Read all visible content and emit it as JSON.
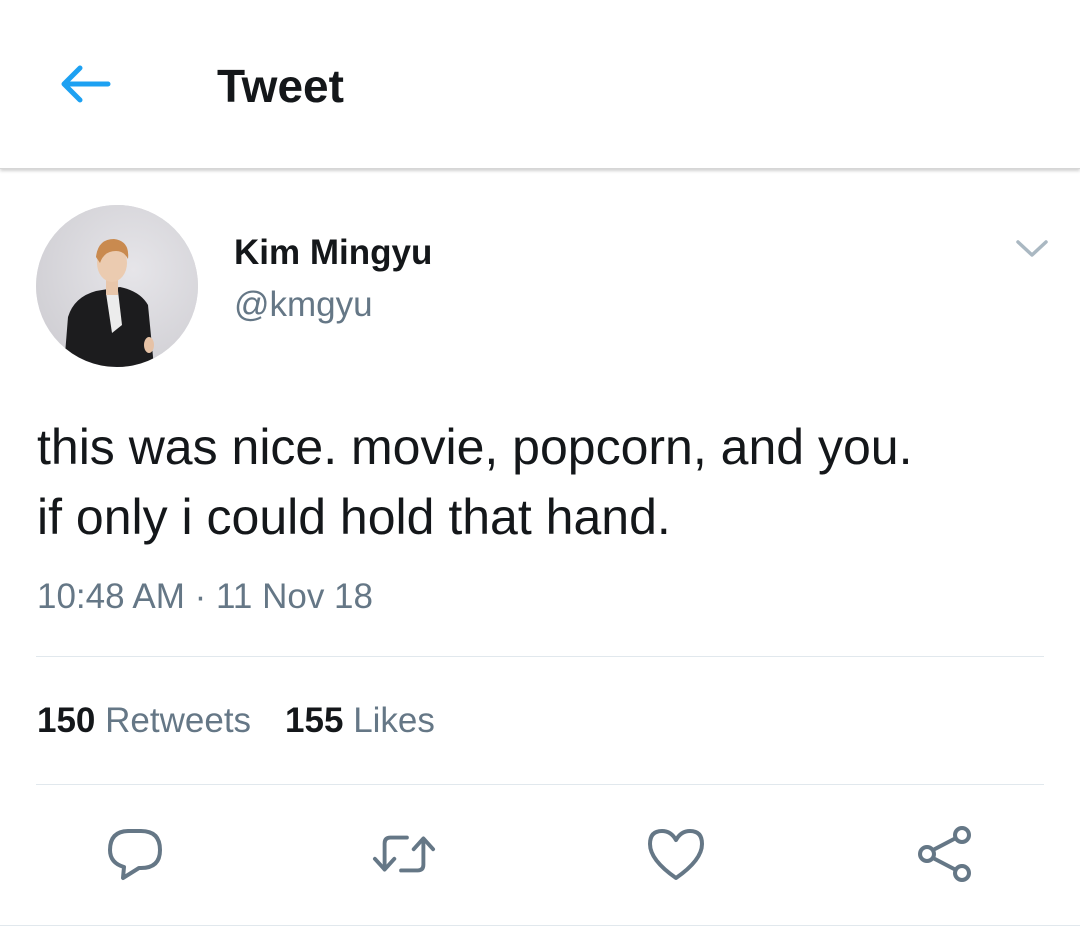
{
  "header": {
    "title": "Tweet"
  },
  "tweet": {
    "author": {
      "name": "Kim Mingyu",
      "handle": "@kmgyu"
    },
    "text_lines": [
      "this was nice. movie, popcorn, and you.",
      "if only i could hold that hand."
    ],
    "time": "10:48 AM",
    "separator": "·",
    "date": "11 Nov 18",
    "stats": {
      "retweets_count": "150",
      "retweets_label": "Retweets",
      "likes_count": "155",
      "likes_label": "Likes"
    }
  },
  "icons": {
    "back": "arrow-left-icon",
    "more": "chevron-down-icon",
    "reply": "reply-icon",
    "retweet": "retweet-icon",
    "like": "heart-icon",
    "share": "share-icon"
  },
  "colors": {
    "accent": "#1da1f2",
    "text_primary": "#14171a",
    "text_secondary": "#657786",
    "divider": "#e1e8ed"
  }
}
